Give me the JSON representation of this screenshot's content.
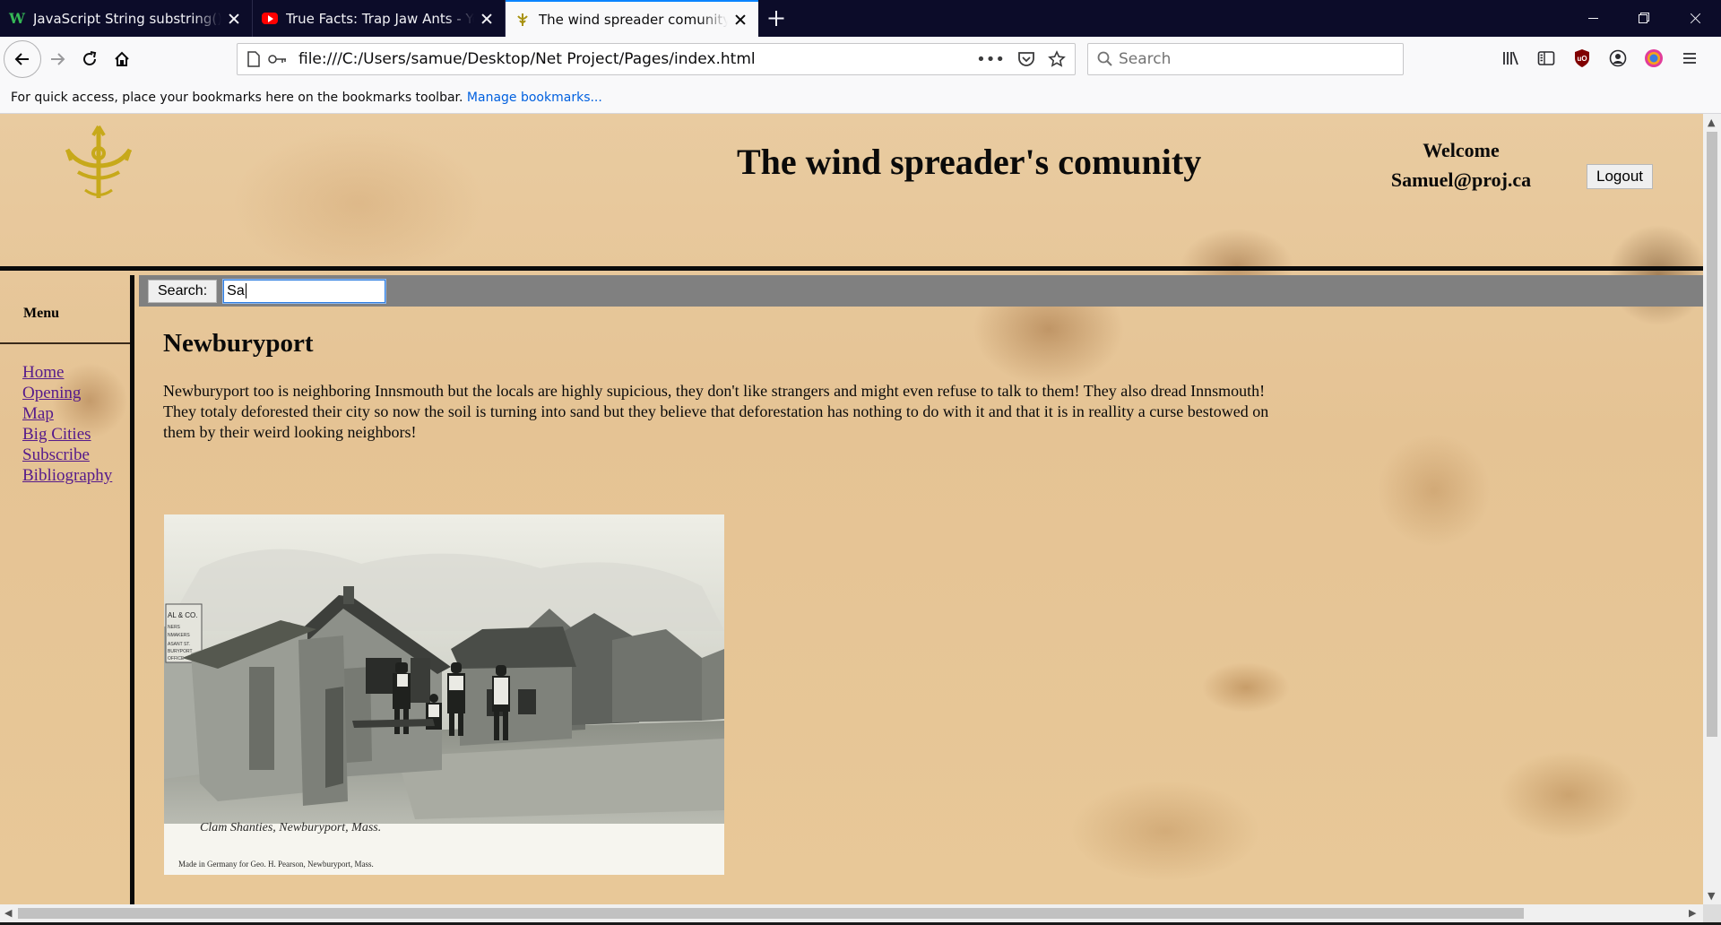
{
  "browser": {
    "tabs": [
      {
        "title": "JavaScript String substring() Me",
        "favicon": "w3schools-icon"
      },
      {
        "title": "True Facts: Trap Jaw Ants - YouT",
        "favicon": "youtube-icon"
      },
      {
        "title": "The wind spreader comunity",
        "favicon": "site-logo-icon"
      }
    ],
    "active_tab": 2,
    "url": "file:///C:/Users/samue/Desktop/Net Project/Pages/index.html",
    "search_placeholder": "Search",
    "bookmarks_text": "For quick access, place your bookmarks here on the bookmarks toolbar.",
    "manage_bookmarks": "Manage bookmarks..."
  },
  "header": {
    "title": "The wind spreader's comunity",
    "welcome": "Welcome",
    "user": "Samuel@proj.ca",
    "logout": "Logout"
  },
  "sidebar": {
    "heading": "Menu",
    "links": [
      "Home",
      "Opening",
      "Map",
      "Big Cities",
      "Subscribe",
      "Bibliography"
    ]
  },
  "search": {
    "label": "Search:",
    "value": "Sa"
  },
  "article": {
    "heading": "Newburyport",
    "body": "Newburyport too is neighboring Innsmouth but the locals are highly supicious, they don't like strangers and might even refuse to talk to them! They also dread Innsmouth! They totaly deforested their city so now the soil is turning into sand but they believe that deforestation has nothing to do with it and that it is in reallity a curse bestowed on them by their weird looking neighbors!",
    "photo_caption": "Clam Shanties, Newburyport, Mass.",
    "photo_credit": "Made in Germany for Geo. H. Pearson, Newburyport, Mass.",
    "photo_sign": "AL & CO.",
    "photo_sign_lines": [
      "NERS",
      "NMAKERS",
      "ASANT ST.",
      "BURYPORT",
      "OFFICE"
    ]
  },
  "colors": {
    "tabbar": "#0c0c29",
    "accent": "#0a84ff",
    "link_visited": "#551a8b",
    "search_strip": "#808080",
    "parchment": "#e7c697"
  }
}
